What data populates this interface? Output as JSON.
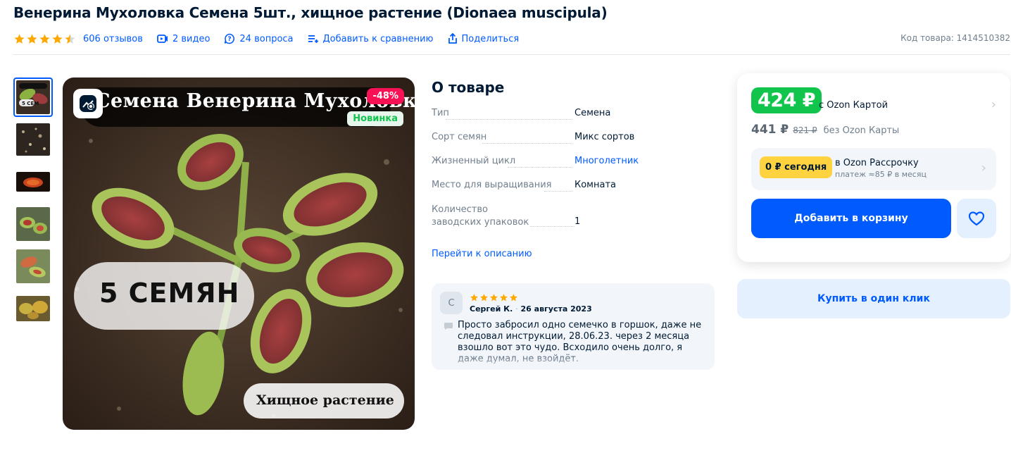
{
  "product": {
    "title": "Венерина Мухоловка Семена 5шт., хищное растение (Dionaea muscipula)",
    "rating": 4.5,
    "reviews_link": "606 отзывов",
    "videos_link": "2 видео",
    "questions_link": "24 вопроса",
    "compare_link": "Добавить к сравнению",
    "share_link": "Поделиться",
    "sku": "Код товара: 1414510382"
  },
  "gallery": {
    "thumbnails": [
      "thumb-1",
      "thumb-2",
      "thumb-3",
      "thumb-4",
      "thumb-5",
      "thumb-6"
    ],
    "main_image": {
      "title_text": "Семена Венерина Мухоловка",
      "seeds_text": "5 СЕМЯН",
      "predator_text": "Хищное растение",
      "discount_badge": "-48%",
      "new_badge": "Новинка"
    }
  },
  "about": {
    "title": "О товаре",
    "characteristics": [
      {
        "name": "Тип",
        "value": "Семена"
      },
      {
        "name": "Сорт семян",
        "value": "Микс сортов"
      },
      {
        "name": "Жизненный цикл",
        "value": "Многолетник"
      },
      {
        "name": "Место для выращивания",
        "value": "Комната"
      },
      {
        "name": "Количество заводских упаковок",
        "value": "1"
      }
    ],
    "goto_description": "Перейти к описанию"
  },
  "review": {
    "avatar_letter": "С",
    "rating": 5,
    "author": "Сергей К.",
    "date": "26 августа 2023",
    "text": "Просто забросил одно семечко в горшок, даже не следовал инструкции, 28.06.23. через 2 месяца взошло вот это чудо. Всходило очень долго, я даже думал, не взойдёт."
  },
  "pricing": {
    "card_price": "424 ₽",
    "card_label": "с Ozon Картой",
    "price_no_card": "441 ₽",
    "price_original": "821 ₽",
    "no_card_label": "без Ozon Карты",
    "installment_badge": "0 ₽ сегодня",
    "installment_title": "в Ozon Рассрочку",
    "installment_sub": "платеж ≈85 ₽ в месяц",
    "add_to_cart": "Добавить в корзину",
    "buy_one_click": "Купить в один клик"
  },
  "colors": {
    "accent": "#005bff",
    "price_green": "#10c44c",
    "discount_red": "#f91155",
    "star_orange": "#ffa800",
    "installment_yellow": "#ffd23f"
  }
}
